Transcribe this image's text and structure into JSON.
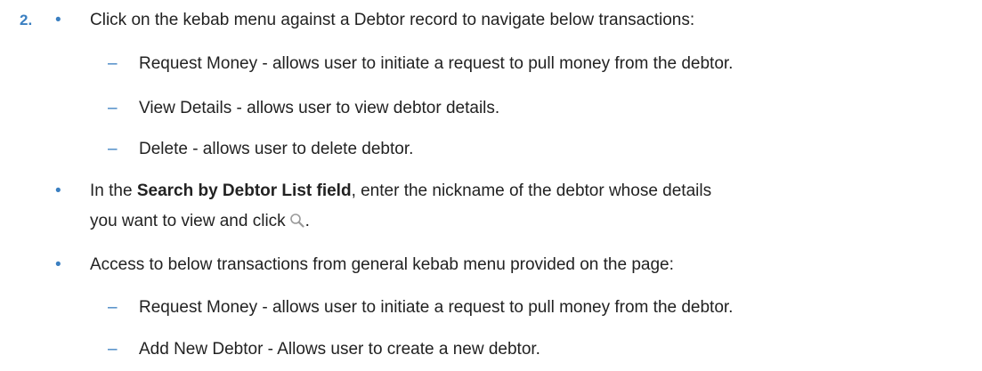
{
  "step": {
    "number": "2."
  },
  "items": {
    "item1": {
      "text": "Click on the kebab menu against a Debtor record to navigate below transactions:",
      "subitems": [
        "Request Money - allows user to initiate a request to pull money from the debtor.",
        "View Details - allows user to view debtor details.",
        "Delete - allows user to delete debtor."
      ]
    },
    "item2": {
      "prefix": "In the ",
      "bold": "Search by Debtor List field",
      "suffix": ", enter the nickname of the debtor whose details",
      "line2": "you want to view and click",
      "end": ".",
      "icon": "search-icon"
    },
    "item3": {
      "text": "Access to below transactions from general kebab menu provided on the page:",
      "subitems": [
        "Request Money - allows user to initiate a request to pull money from the debtor.",
        "Add New Debtor - Allows user to create a new debtor."
      ]
    }
  },
  "colors": {
    "accent": "#3a7fc1",
    "text": "#222222"
  }
}
